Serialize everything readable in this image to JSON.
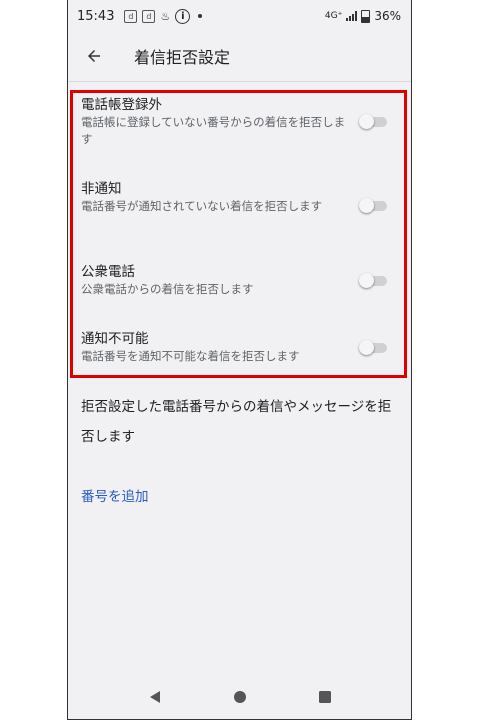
{
  "status_bar": {
    "time": "15:43",
    "left_icons": [
      "d",
      "d",
      "♨"
    ],
    "network": "4G⁺",
    "battery": "36%"
  },
  "header": {
    "back_icon": "arrow-left-icon",
    "title": "着信拒否設定"
  },
  "settings": [
    {
      "title": "電話帳登録外",
      "description": "電話帳に登録していない番号からの着信を拒否します",
      "enabled": false
    },
    {
      "title": "非通知",
      "description": "電話番号が通知されていない着信を拒否します",
      "enabled": false
    },
    {
      "title": "公衆電話",
      "description": "公衆電話からの着信を拒否します",
      "enabled": false
    },
    {
      "title": "通知不可能",
      "description": "電話番号を通知不可能な着信を拒否します",
      "enabled": false
    }
  ],
  "info_text": "拒否設定した電話番号からの着信やメッセージを拒否します",
  "add_number_label": "番号を追加",
  "colors": {
    "highlight": "#e10000",
    "link": "#2a5bc4",
    "background": "#f1f1f3"
  }
}
